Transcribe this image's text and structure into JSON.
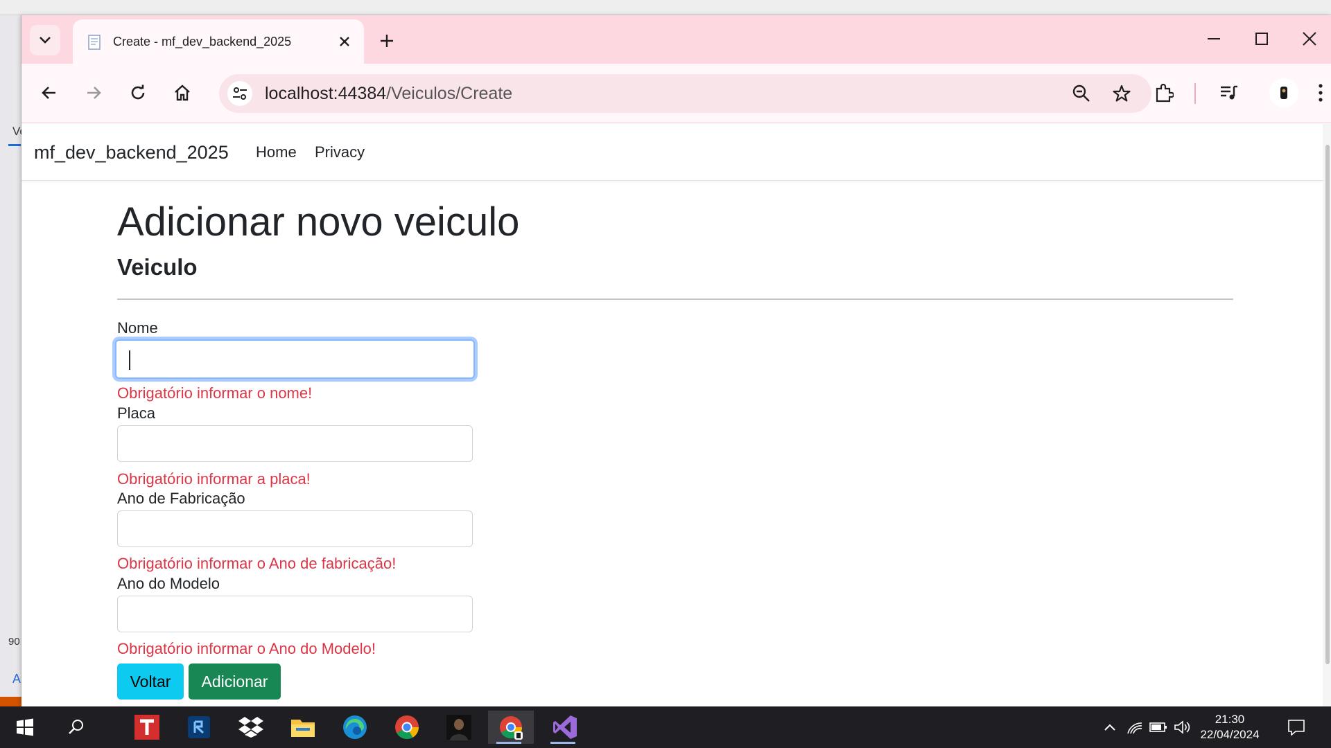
{
  "browser": {
    "tab_title": "Create - mf_dev_backend_2025",
    "url_host": "localhost:44384",
    "url_path": "/Veiculos/Create"
  },
  "background_app": {
    "tab_letter": "Ve",
    "zoom_fragment": "90",
    "link_letter": "A"
  },
  "site": {
    "brand": "mf_dev_backend_2025",
    "nav": [
      {
        "label": "Home"
      },
      {
        "label": "Privacy"
      }
    ]
  },
  "page": {
    "title": "Adicionar novo veiculo",
    "subtitle": "Veiculo"
  },
  "form": {
    "fields": [
      {
        "label": "Nome",
        "value": "",
        "error": "Obrigatório informar o nome!"
      },
      {
        "label": "Placa",
        "value": "",
        "error": "Obrigatório informar a placa!"
      },
      {
        "label": "Ano de Fabricação",
        "value": "",
        "error": "Obrigatório informar o Ano de fabricação!"
      },
      {
        "label": "Ano do Modelo",
        "value": "",
        "error": "Obrigatório informar o Ano do Modelo!"
      }
    ],
    "back_label": "Voltar",
    "submit_label": "Adicionar"
  },
  "taskbar": {
    "time": "21:30",
    "date": "22/04/2024",
    "apps": [
      "start-icon",
      "search-icon",
      "t-app-icon",
      "blue-app-icon",
      "dropbox-icon",
      "file-explorer-icon",
      "edge-icon",
      "chrome-icon",
      "profile-app-icon",
      "chrome-profile-icon",
      "visual-studio-icon"
    ]
  },
  "colors": {
    "tabbar_bg": "#fdd8e1",
    "toolbar_bg": "#fff7f9",
    "error": "#dc3545",
    "btn_info": "#0dcaf0",
    "btn_success": "#198754",
    "focus_ring": "#86b7fe"
  }
}
